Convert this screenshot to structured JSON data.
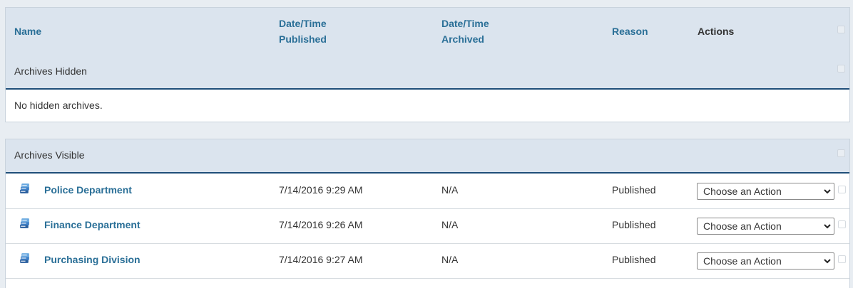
{
  "columns": {
    "name": "Name",
    "published_line1": "Date/Time",
    "published_line2": "Published",
    "archived_line1": "Date/Time",
    "archived_line2": "Archived",
    "reason": "Reason",
    "actions": "Actions"
  },
  "hidden_section": {
    "title": "Archives Hidden",
    "empty_message": "No hidden archives."
  },
  "visible_section": {
    "title": "Archives Visible",
    "rows": [
      {
        "name": "Police Department",
        "published": "7/14/2016 9:29 AM",
        "archived": "N/A",
        "reason": "Published",
        "action": "Choose an Action",
        "icon": "archive-icon"
      },
      {
        "name": "Finance Department",
        "published": "7/14/2016 9:26 AM",
        "archived": "N/A",
        "reason": "Published",
        "action": "Choose an Action",
        "icon": "archive-icon"
      },
      {
        "name": "Purchasing Division",
        "published": "7/14/2016 9:27 AM",
        "archived": "N/A",
        "reason": "Published",
        "action": "Choose an Action",
        "icon": "archive-icon"
      }
    ]
  },
  "colors": {
    "link": "#2a6f97",
    "header_bg": "#dbe4ee",
    "accent_rule": "#1f4e79",
    "page_bg": "#e8edf2"
  }
}
